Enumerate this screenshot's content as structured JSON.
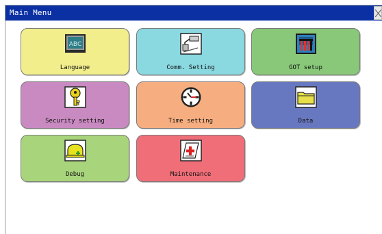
{
  "window": {
    "title": "Main Menu"
  },
  "menu": [
    {
      "label": "Language",
      "icon": "abc-screen-icon",
      "color": "#f2ee8c"
    },
    {
      "label": "Comm. Setting",
      "icon": "cable-connector-icon",
      "color": "#8ad8e0"
    },
    {
      "label": "GOT setup",
      "icon": "got-panel-icon",
      "color": "#88c878"
    },
    {
      "label": "Security setting",
      "icon": "key-icon",
      "color": "#c88ac0"
    },
    {
      "label": "Time setting",
      "icon": "clock-icon",
      "color": "#f6ae80"
    },
    {
      "label": "Data",
      "icon": "folder-icon",
      "color": "#6878c0"
    },
    {
      "label": "Debug",
      "icon": "helmet-icon",
      "color": "#a8d47c"
    },
    {
      "label": "Maintenance",
      "icon": "first-aid-document-icon",
      "color": "#ef6e78"
    }
  ]
}
